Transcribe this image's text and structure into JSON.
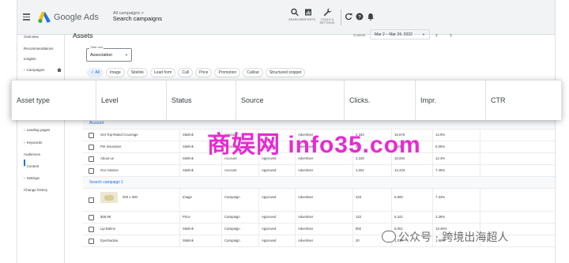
{
  "header": {
    "app_name": "Google Ads",
    "breadcrumb_small": "All campaigns  >",
    "breadcrumb_main": "Search campaigns",
    "tools": [
      {
        "label": "SEARCH",
        "icon": "search-icon"
      },
      {
        "label": "REPORTS",
        "icon": "reports-icon"
      },
      {
        "label": "TOOLS & SETTINGS",
        "icon": "wrench-icon"
      }
    ]
  },
  "sidebar": {
    "items": [
      {
        "label": "Overview",
        "expandable": false
      },
      {
        "label": "Recommendations",
        "expandable": false
      },
      {
        "label": "Insights",
        "expandable": false
      },
      {
        "label": "Campaigns",
        "expandable": true
      },
      {
        "label": "Landing pages",
        "expandable": true
      },
      {
        "label": "Keywords",
        "expandable": true
      },
      {
        "label": "Audiences",
        "expandable": false
      },
      {
        "label": "Content",
        "expandable": true
      },
      {
        "label": "Settings",
        "expandable": true
      },
      {
        "label": "Change history",
        "expandable": false
      }
    ]
  },
  "main": {
    "title": "Assets",
    "date_label": "Custom",
    "date_range": "Mar 2 – Mar 24, 2022",
    "table_view_label": "Table view",
    "table_view_value": "Association",
    "chips": [
      "All",
      "Image",
      "Sitelink",
      "Lead form",
      "Call",
      "Price",
      "Promotion",
      "Callout",
      "Structured snippet"
    ],
    "active_chip": "All"
  },
  "columns": [
    "Asset type",
    "Level",
    "Status",
    "Source",
    "Clicks.",
    "Impr.",
    "CTR"
  ],
  "groups": [
    {
      "title": "Account",
      "rows": [
        {
          "name": "Get Top-Rated Coverage",
          "type": "Sitelink",
          "level": "Account",
          "status": "Approved",
          "source": "Advertiser",
          "clicks": "2,334",
          "impr": "15,676",
          "ctr": "14.9%"
        },
        {
          "name": "Pet Insurance",
          "type": "Sitelink",
          "level": "Account",
          "status": "Approved",
          "source": "Advertiser",
          "clicks": "317",
          "impr": "5,342",
          "ctr": "5.06%"
        },
        {
          "name": "About us",
          "type": "Sitelink",
          "level": "Account",
          "status": "Approved",
          "source": "Advertiser",
          "clicks": "2,228",
          "impr": "18,094",
          "ctr": "12.3%"
        },
        {
          "name": "Our mission",
          "type": "Sitelink",
          "level": "Account",
          "status": "Approved",
          "source": "Advertiser",
          "clicks": "1,001",
          "impr": "13,433",
          "ctr": "7.45%"
        }
      ]
    },
    {
      "title": "Search campaign 1",
      "rows": [
        {
          "name": "300 x 300",
          "type": "Image",
          "level": "Campaign",
          "status": "Approved",
          "source": "Advertiser",
          "clicks": "433",
          "impr": "5,900",
          "ctr": "7.33%"
        },
        {
          "name": "$49.99",
          "type": "Price",
          "level": "Campaign",
          "status": "Approved",
          "source": "Advertiser",
          "clicks": "122",
          "impr": "5,341",
          "ctr": "2.28%"
        },
        {
          "name": "Lip Balms",
          "type": "Sitelink",
          "level": "Campaign",
          "status": "Approved",
          "source": "Advertiser",
          "clicks": "802",
          "impr": "6,001",
          "ctr": "13.36%"
        },
        {
          "name": "Eyeshadow",
          "type": "Sitelink",
          "level": "Campaign",
          "status": "Approved",
          "source": "Advertiser",
          "clicks": "20",
          "impr": "1,010",
          "ctr": "1.98%"
        }
      ]
    }
  ],
  "watermark": {
    "main": "商娱网 info35.com",
    "wechat": "公众号 · 跨境出海超人"
  },
  "colors": {
    "accent": "#1a73e8",
    "watermark": "#e72ad1",
    "topbar": "#f1f3f4"
  }
}
